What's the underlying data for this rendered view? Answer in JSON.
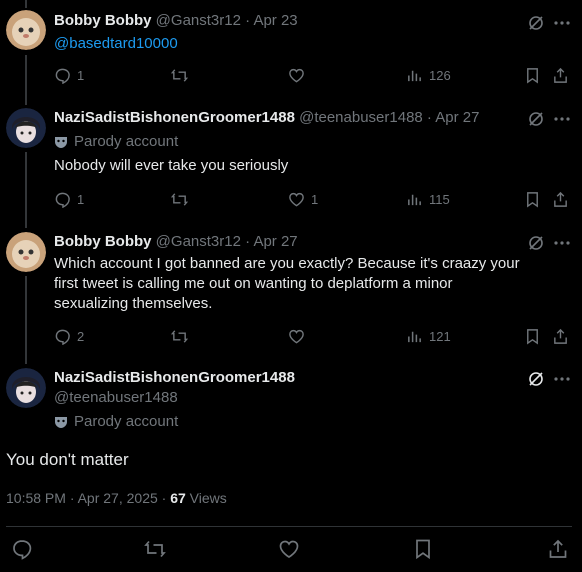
{
  "tweets": [
    {
      "name": "Bobby Bobby",
      "handle": "@Ganst3r12 · Apr 23",
      "text_link": "@basedtard10000",
      "replies": "1",
      "likes": "",
      "views": "126"
    },
    {
      "name": "NaziSadistBishonenGroomer1488",
      "handle": "@teenabuser1488 · Apr 27",
      "parody": "Parody account",
      "text": "Nobody will ever take you seriously",
      "replies": "1",
      "likes": "1",
      "views": "115"
    },
    {
      "name": "Bobby Bobby",
      "handle": "@Ganst3r12 · Apr 27",
      "text": "Which account I got banned are you exactly? Because it's craazy your first tweet is calling me out on wanting to deplatform a minor sexualizing themselves.",
      "replies": "2",
      "likes": "",
      "views": "121"
    }
  ],
  "main": {
    "name": "NaziSadistBishonenGroomer1488",
    "handle": "@teenabuser1488",
    "parody": "Parody account",
    "text": "You don't matter",
    "timestamp": "10:58 PM · Apr 27, 2025 · ",
    "views_count": "67",
    "views_label": " Views"
  },
  "icons": {
    "reply": "reply-icon",
    "retweet": "retweet-icon",
    "like": "heart-icon",
    "views": "views-icon",
    "bookmark": "bookmark-icon",
    "share": "share-icon",
    "grok": "grok-icon",
    "more": "more-icon"
  },
  "colors": {
    "background": "#000000",
    "text": "#e7e9ea",
    "muted": "#71767b",
    "link": "#1d9bf0"
  }
}
